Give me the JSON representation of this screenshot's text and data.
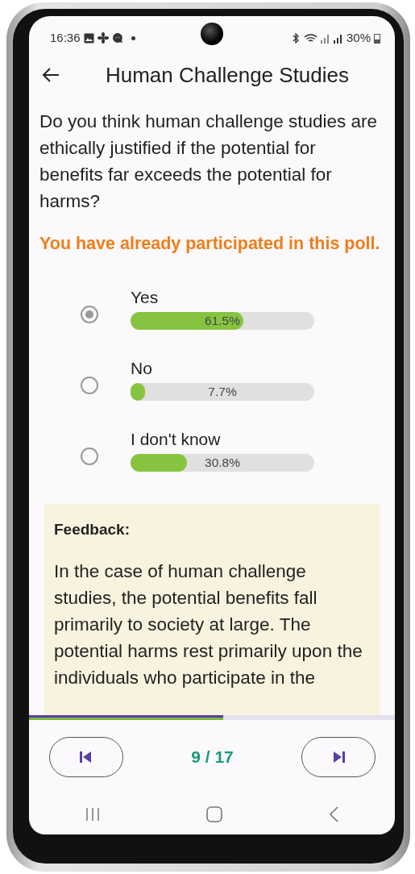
{
  "status_bar": {
    "time": "16:36",
    "battery": "30%"
  },
  "header": {
    "title": "Human Challenge Studies"
  },
  "question": "Do you think human challenge studies are ethically justified if the potential for benefits far exceeds the potential for harms?",
  "notice": "You have already participated in this poll.",
  "options": [
    {
      "label": "Yes",
      "reading": "61.5%",
      "level": 0.615,
      "selected": true
    },
    {
      "label": "No",
      "reading": "7.7%",
      "level": 0.077,
      "selected": false
    },
    {
      "label": "I don't know",
      "reading": "30.8%",
      "level": 0.308,
      "selected": false
    }
  ],
  "feedback": {
    "heading": "Feedback:",
    "text": "In the case of human challenge studies, the potential benefits fall primarily to society at large. The potential harms rest primarily upon the individuals who participate in the"
  },
  "progress": {
    "level": 0.53
  },
  "pager": {
    "counter": "9 / 17"
  }
}
